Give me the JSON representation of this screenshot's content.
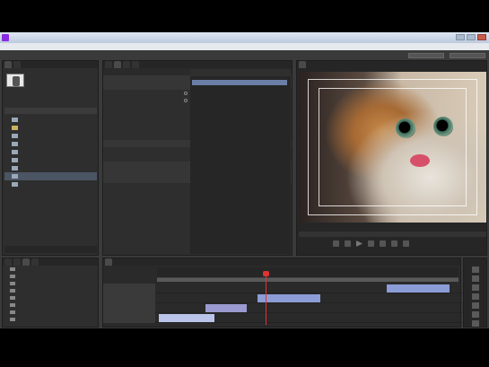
{
  "window": {},
  "menu": [],
  "workspace": {},
  "project_panel": {
    "tabs": [],
    "info_lines": [],
    "columns": {},
    "items": [
      {
        "type": "image",
        "selected": false
      },
      {
        "type": "folder",
        "selected": false
      },
      {
        "type": "image",
        "selected": false
      },
      {
        "type": "image",
        "selected": false
      },
      {
        "type": "image",
        "selected": false
      },
      {
        "type": "image",
        "selected": false
      },
      {
        "type": "image",
        "selected": false
      },
      {
        "type": "image",
        "selected": true
      },
      {
        "type": "image",
        "selected": false
      }
    ]
  },
  "effect_controls": {
    "tabs": [],
    "rows": [],
    "timeline_clip": ""
  },
  "program_monitor": {
    "tab": "",
    "timecode_current": "",
    "timecode_duration": ""
  },
  "effects_panel": {
    "tabs": [],
    "items": []
  },
  "timeline": {
    "tab": "",
    "timecode": "",
    "ruler_labels": [],
    "video_tracks": [],
    "clips": [],
    "audio_tracks": []
  },
  "colors": {
    "accent_timecode": "#e0a534",
    "clip_video": "#8b9cd6",
    "playhead": "#dd3333",
    "panel_bg": "#2e2e2e"
  }
}
